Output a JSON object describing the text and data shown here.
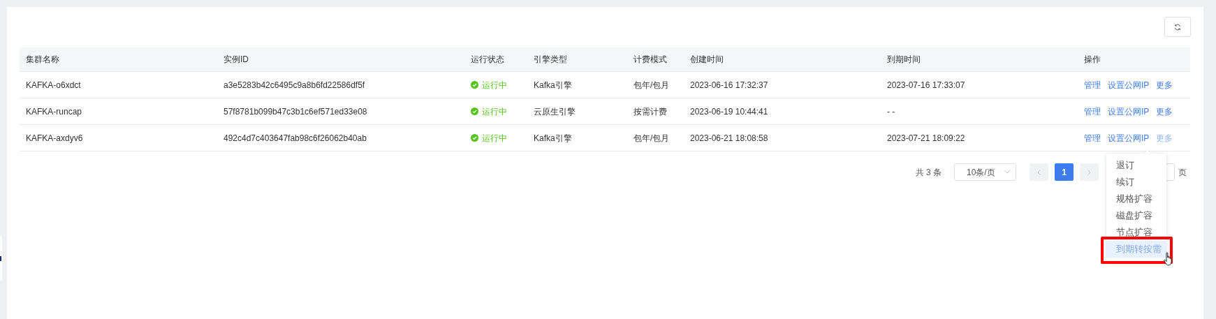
{
  "table": {
    "columns": [
      "集群名称",
      "实例ID",
      "运行状态",
      "引擎类型",
      "计费模式",
      "创建时间",
      "到期时间",
      "操作"
    ],
    "rows": [
      {
        "name": "KAFKA-o6xdct",
        "instance_id": "a3e5283b42c6495c9a8b6fd22586df5f",
        "status": {
          "kind": "running",
          "label": "运行中",
          "color": "#52c41a"
        },
        "engine": "Kafka引擎",
        "billing": "包年/包月",
        "created": "2023-06-16 17:32:37",
        "expires": "2023-07-16 17:33:07",
        "actions": [
          {
            "label": "管理",
            "hovered": false
          },
          {
            "label": "设置公网IP",
            "hovered": false
          },
          {
            "label": "更多",
            "hovered": false
          }
        ]
      },
      {
        "name": "KAFKA-runcap",
        "instance_id": "57f8781b099b47c3b1c6ef571ed33e08",
        "status": {
          "kind": "running",
          "label": "运行中",
          "color": "#52c41a"
        },
        "engine": "云原生引擎",
        "billing": "按需计费",
        "created": "2023-06-19 10:44:41",
        "expires": "- -",
        "actions": [
          {
            "label": "管理",
            "hovered": false
          },
          {
            "label": "设置公网IP",
            "hovered": false
          },
          {
            "label": "更多",
            "hovered": false
          }
        ]
      },
      {
        "name": "KAFKA-axdyv6",
        "instance_id": "492c4d7c403647fab98c6f26062b40ab",
        "status": {
          "kind": "running",
          "label": "运行中",
          "color": "#52c41a"
        },
        "engine": "Kafka引擎",
        "billing": "包年/包月",
        "created": "2023-06-21 18:08:58",
        "expires": "2023-07-21 18:09:22",
        "actions": [
          {
            "label": "管理",
            "hovered": false
          },
          {
            "label": "设置公网IP",
            "hovered": false
          },
          {
            "label": "更多",
            "hovered": true
          }
        ]
      }
    ]
  },
  "pagination": {
    "total": "共 3 条",
    "page_size": "10条/页",
    "pages": [
      {
        "label": "1",
        "selected": true
      }
    ],
    "page_suffix": "页"
  },
  "more_menu": {
    "items": [
      {
        "label": "退订",
        "hovered": false
      },
      {
        "label": "续订",
        "hovered": false
      },
      {
        "label": "规格扩容",
        "hovered": false
      },
      {
        "label": "磁盘扩容",
        "hovered": false
      },
      {
        "label": "节点扩容",
        "hovered": false
      },
      {
        "label": "到期转按需",
        "hovered": true
      }
    ]
  }
}
